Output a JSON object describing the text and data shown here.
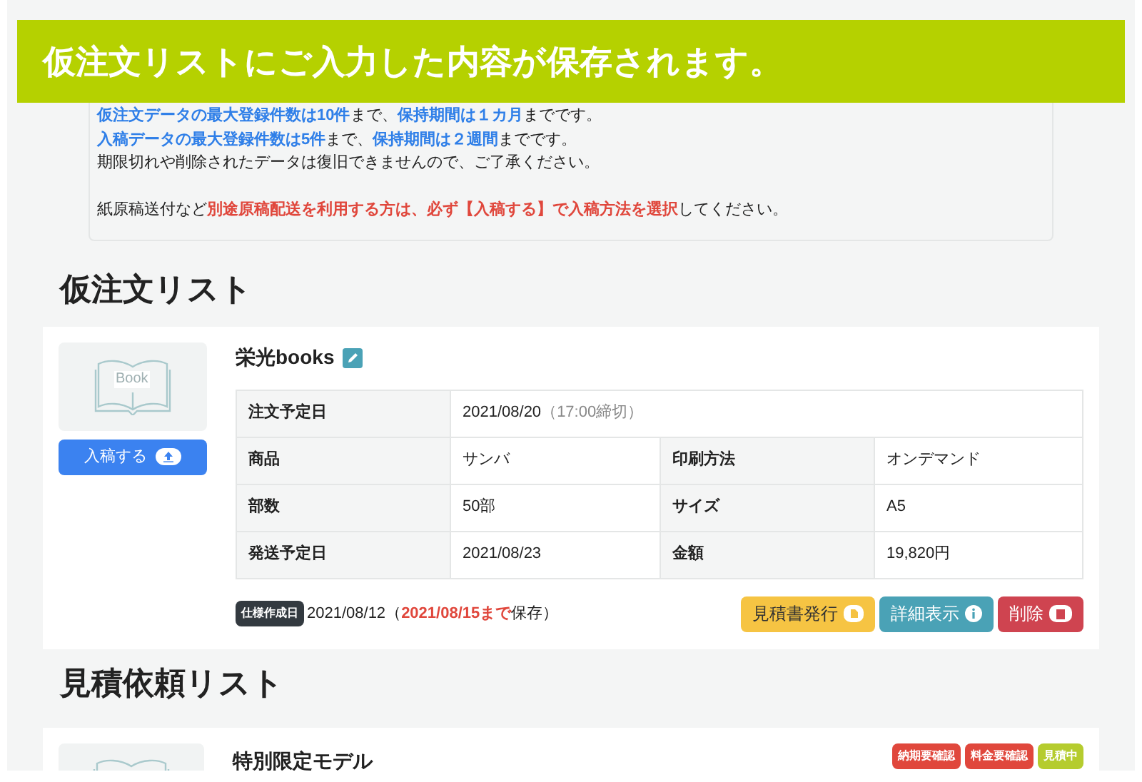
{
  "banner": {
    "title": "仮注文リストにご入力した内容が保存されます。"
  },
  "notice": {
    "paragraphs": [
      [
        [
          {
            "text": "仮注文データの最大登録件数は10件",
            "kind": "blue"
          },
          {
            "text": "まで、",
            "kind": "plain"
          },
          {
            "text": "保持期間は１カ月",
            "kind": "blue"
          },
          {
            "text": "までです。",
            "kind": "plain"
          }
        ],
        [
          {
            "text": "入稿データの最大登録件数は5件",
            "kind": "blue"
          },
          {
            "text": "まで、",
            "kind": "plain"
          },
          {
            "text": "保持期間は２週間",
            "kind": "blue"
          },
          {
            "text": "までです。",
            "kind": "plain"
          }
        ],
        [
          {
            "text": "期限切れや削除されたデータは復旧できませんので、ご了承ください。",
            "kind": "plain"
          }
        ]
      ],
      [
        [
          {
            "text": "紙原稿送付など",
            "kind": "plain"
          },
          {
            "text": "別途原稿配送を利用する方は、必ず【入稿する】で入稿方法を選択",
            "kind": "red"
          },
          {
            "text": "してください。",
            "kind": "plain"
          }
        ]
      ]
    ]
  },
  "order_section": {
    "heading": "仮注文リスト",
    "card": {
      "thumbnail_label": "Book",
      "upload_button": "入稿する",
      "title": "栄光books",
      "table": [
        {
          "label": "注文予定日",
          "value": "2021/08/20",
          "note": "（17:00締切）"
        },
        {
          "label": "商品",
          "value": "サンバ",
          "label_2": "印刷方法",
          "value_2": "オンデマンド"
        },
        {
          "label": "部数",
          "value": "50部",
          "label_2": "サイズ",
          "value_2": "A5"
        },
        {
          "label": "発送予定日",
          "value": "2021/08/23",
          "label_2": "金額",
          "value_2": "19,820円"
        }
      ],
      "created_badge": "仕様作成日",
      "created_date": "2021/08/12",
      "keep_open": "（",
      "keep_until": "2021/08/15まで",
      "keep_close": "保存）",
      "actions": [
        {
          "label": "見積書発行",
          "kind": "quote"
        },
        {
          "label": "詳細表示",
          "kind": "detail"
        },
        {
          "label": "削除",
          "kind": "delete"
        }
      ]
    }
  },
  "estimate_section": {
    "heading": "見積依頼リスト",
    "card": {
      "title": "特別限定モデル",
      "tags": [
        {
          "label": "納期要確認",
          "color": "#e0473c"
        },
        {
          "label": "料金要確認",
          "color": "#e0473c"
        },
        {
          "label": "見積中",
          "color": "#b5cc2e"
        }
      ]
    }
  }
}
